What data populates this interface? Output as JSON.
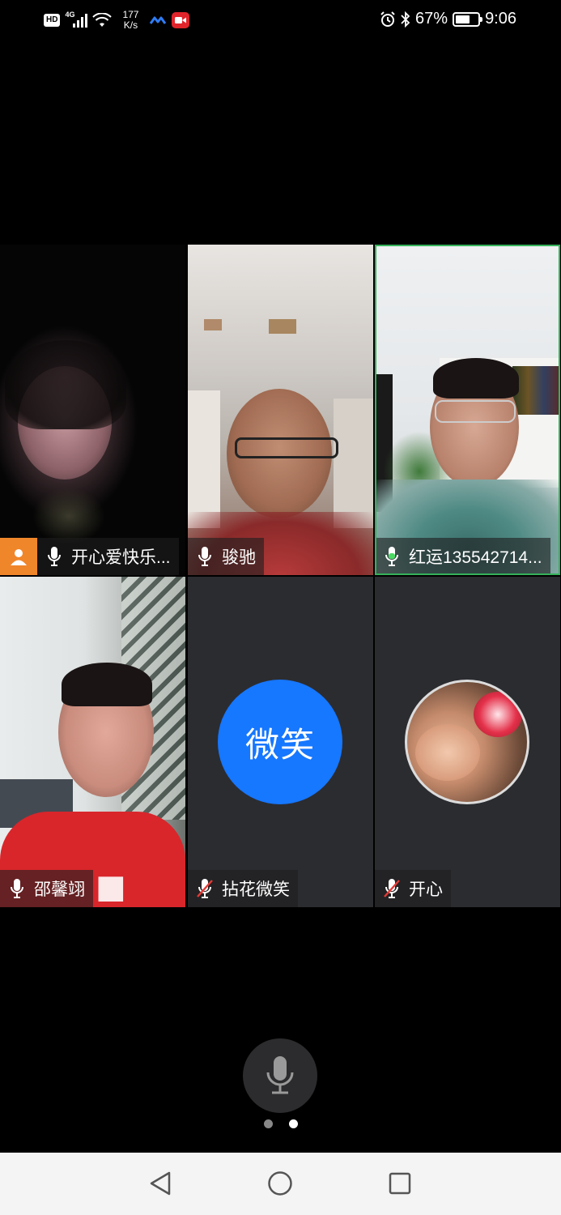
{
  "status_bar": {
    "hd_badge": "HD",
    "network_type": "4G",
    "speed_value": "177",
    "speed_unit": "K/s",
    "battery_percent": "67%",
    "battery_level": 0.67,
    "time": "9:06"
  },
  "participants": [
    {
      "name": "开心爱快乐...",
      "mic": "on",
      "is_host": true
    },
    {
      "name": "骏驰",
      "mic": "on"
    },
    {
      "name": "红运135542714...",
      "mic": "speaking",
      "active": true
    },
    {
      "name": "邵馨翊",
      "mic": "on"
    },
    {
      "name": "拈花微笑",
      "mic": "muted",
      "avatar_text": "微笑",
      "avatar_color": "#1677ff"
    },
    {
      "name": "开心",
      "mic": "muted",
      "avatar": "photo"
    }
  ],
  "controls": {
    "mic_icon": "microphone-icon",
    "page_count": 2,
    "current_page": 2
  },
  "nav_bar": {
    "back_icon": "triangle-back-icon",
    "home_icon": "circle-home-icon",
    "recents_icon": "square-recents-icon"
  },
  "colors": {
    "host_badge": "#f0862a",
    "active_border": "#35b15a",
    "speaking_mic": "#4cd964",
    "muted_mic_slash": "#e53935",
    "empty_tile": "#2b2c30"
  }
}
